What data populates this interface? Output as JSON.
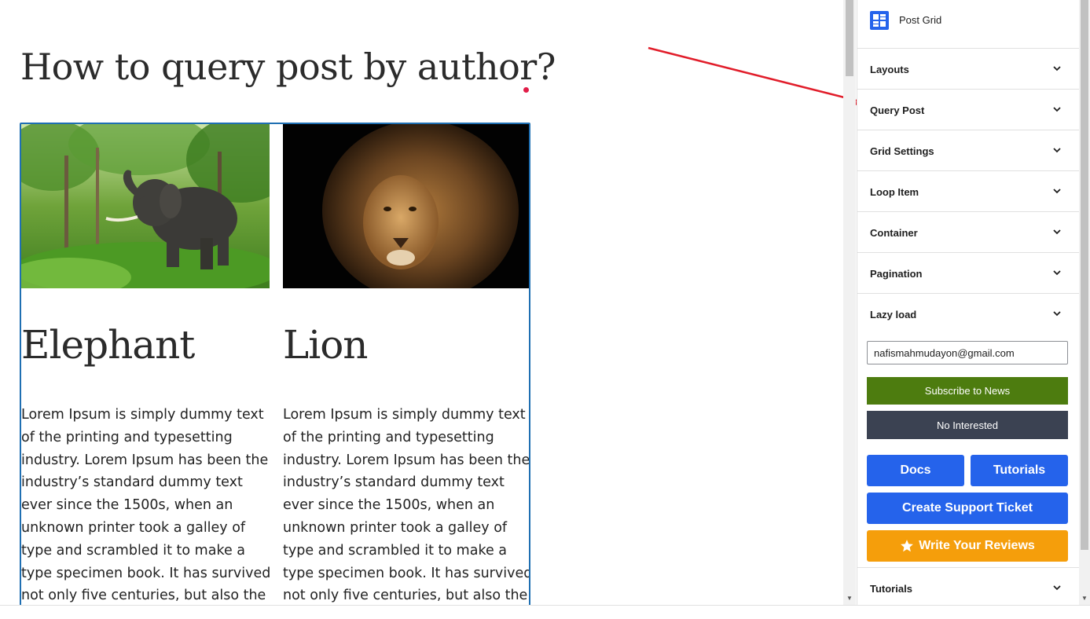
{
  "post": {
    "title": "How to query post by author?"
  },
  "grid": {
    "items": [
      {
        "title": "Elephant",
        "image": "elephant-photo",
        "excerpt": "Lorem Ipsum is simply dummy text of the printing and typesetting industry. Lorem Ipsum has been the industry’s standard dummy text ever since the 1500s, when an unknown printer took a galley of type and scrambled it to make a type specimen book. It has survived not only five centuries, but also the leap into electronic typesetting,"
      },
      {
        "title": "Lion",
        "image": "lion-photo",
        "excerpt": "Lorem Ipsum is simply dummy text of the printing and typesetting industry. Lorem Ipsum has been the industry’s standard dummy text ever since the 1500s, when an unknown printer took a galley of type and scrambled it to make a type specimen book. It has survived not only five centuries, but also the leap into electronic typesetting,"
      }
    ]
  },
  "sidebar": {
    "block_name": "Post Grid",
    "panels": [
      {
        "label": "Layouts"
      },
      {
        "label": "Query Post"
      },
      {
        "label": "Grid Settings"
      },
      {
        "label": "Loop Item"
      },
      {
        "label": "Container"
      },
      {
        "label": "Pagination"
      },
      {
        "label": "Lazy load"
      }
    ],
    "promo": {
      "email_value": "nafismahmudayon@gmail.com",
      "subscribe_label": "Subscribe to News",
      "no_interest_label": "No Interested",
      "docs_label": "Docs",
      "tutorials_label": "Tutorials",
      "support_label": "Create Support Ticket",
      "reviews_label": "Write Your Reviews"
    },
    "last_panel": {
      "label": "Tutorials"
    }
  },
  "colors": {
    "accent_blue": "#2563eb",
    "subscribe_green": "#4d7c0f",
    "no_interest_dark": "#3b4252",
    "review_amber": "#f59e0b",
    "grid_border": "#1f6fb2",
    "annotation_arrow": "#e11d2a",
    "title_dot": "#e11d48"
  }
}
